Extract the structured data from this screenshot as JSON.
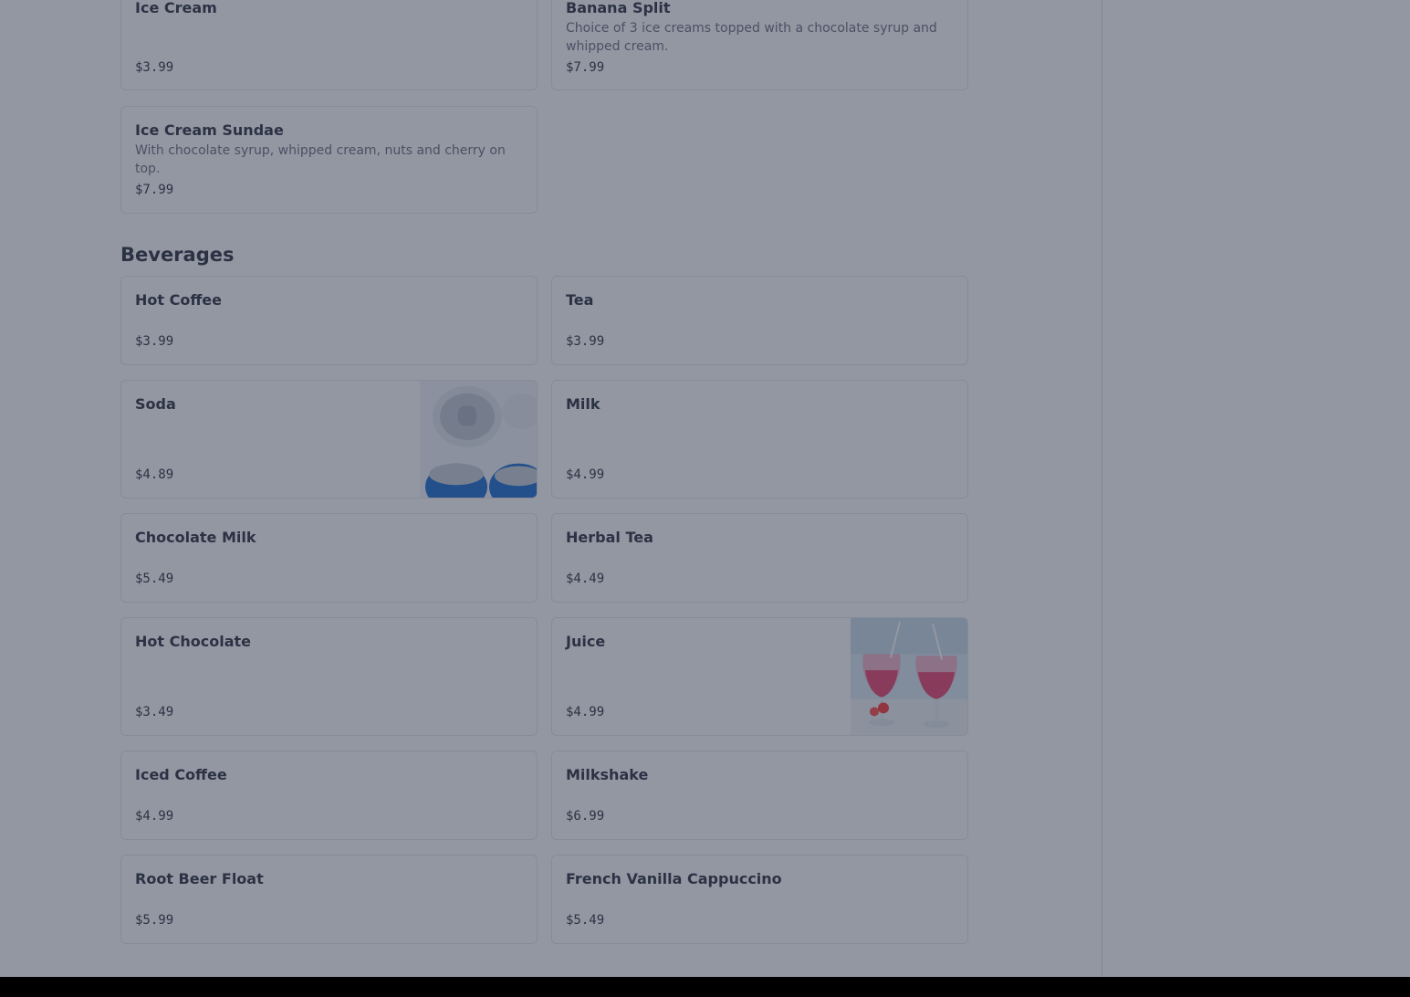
{
  "desserts": [
    {
      "name": "Ice Cream",
      "description": "",
      "price": "$3.99"
    },
    {
      "name": "Banana Split",
      "description": "Choice of 3 ice creams topped with a chocolate syrup and whipped cream.",
      "price": "$7.99"
    },
    {
      "name": "Ice Cream Sundae",
      "description": "With chocolate syrup, whipped cream, nuts and cherry on top.",
      "price": "$7.99"
    }
  ],
  "beverages": {
    "title": "Beverages",
    "items": [
      {
        "name": "Hot Coffee",
        "price": "$3.99"
      },
      {
        "name": "Tea",
        "price": "$3.99"
      },
      {
        "name": "Soda",
        "price": "$4.89",
        "image": "soda-cans-image"
      },
      {
        "name": "Milk",
        "price": "$4.99"
      },
      {
        "name": "Chocolate Milk",
        "price": "$5.49"
      },
      {
        "name": "Herbal Tea",
        "price": "$4.49"
      },
      {
        "name": "Hot Chocolate",
        "price": "$3.49"
      },
      {
        "name": "Juice",
        "price": "$4.99",
        "image": "pink-drinks-image"
      },
      {
        "name": "Iced Coffee",
        "price": "$4.99"
      },
      {
        "name": "Milkshake",
        "price": "$6.99"
      },
      {
        "name": "Root Beer Float",
        "price": "$5.99"
      },
      {
        "name": "French Vanilla Cappuccino",
        "price": "$5.49"
      }
    ]
  },
  "colors": {
    "overlay": "#283046",
    "text": "#2f3542",
    "muted": "#6c7280",
    "border": "#e4e6ea"
  }
}
